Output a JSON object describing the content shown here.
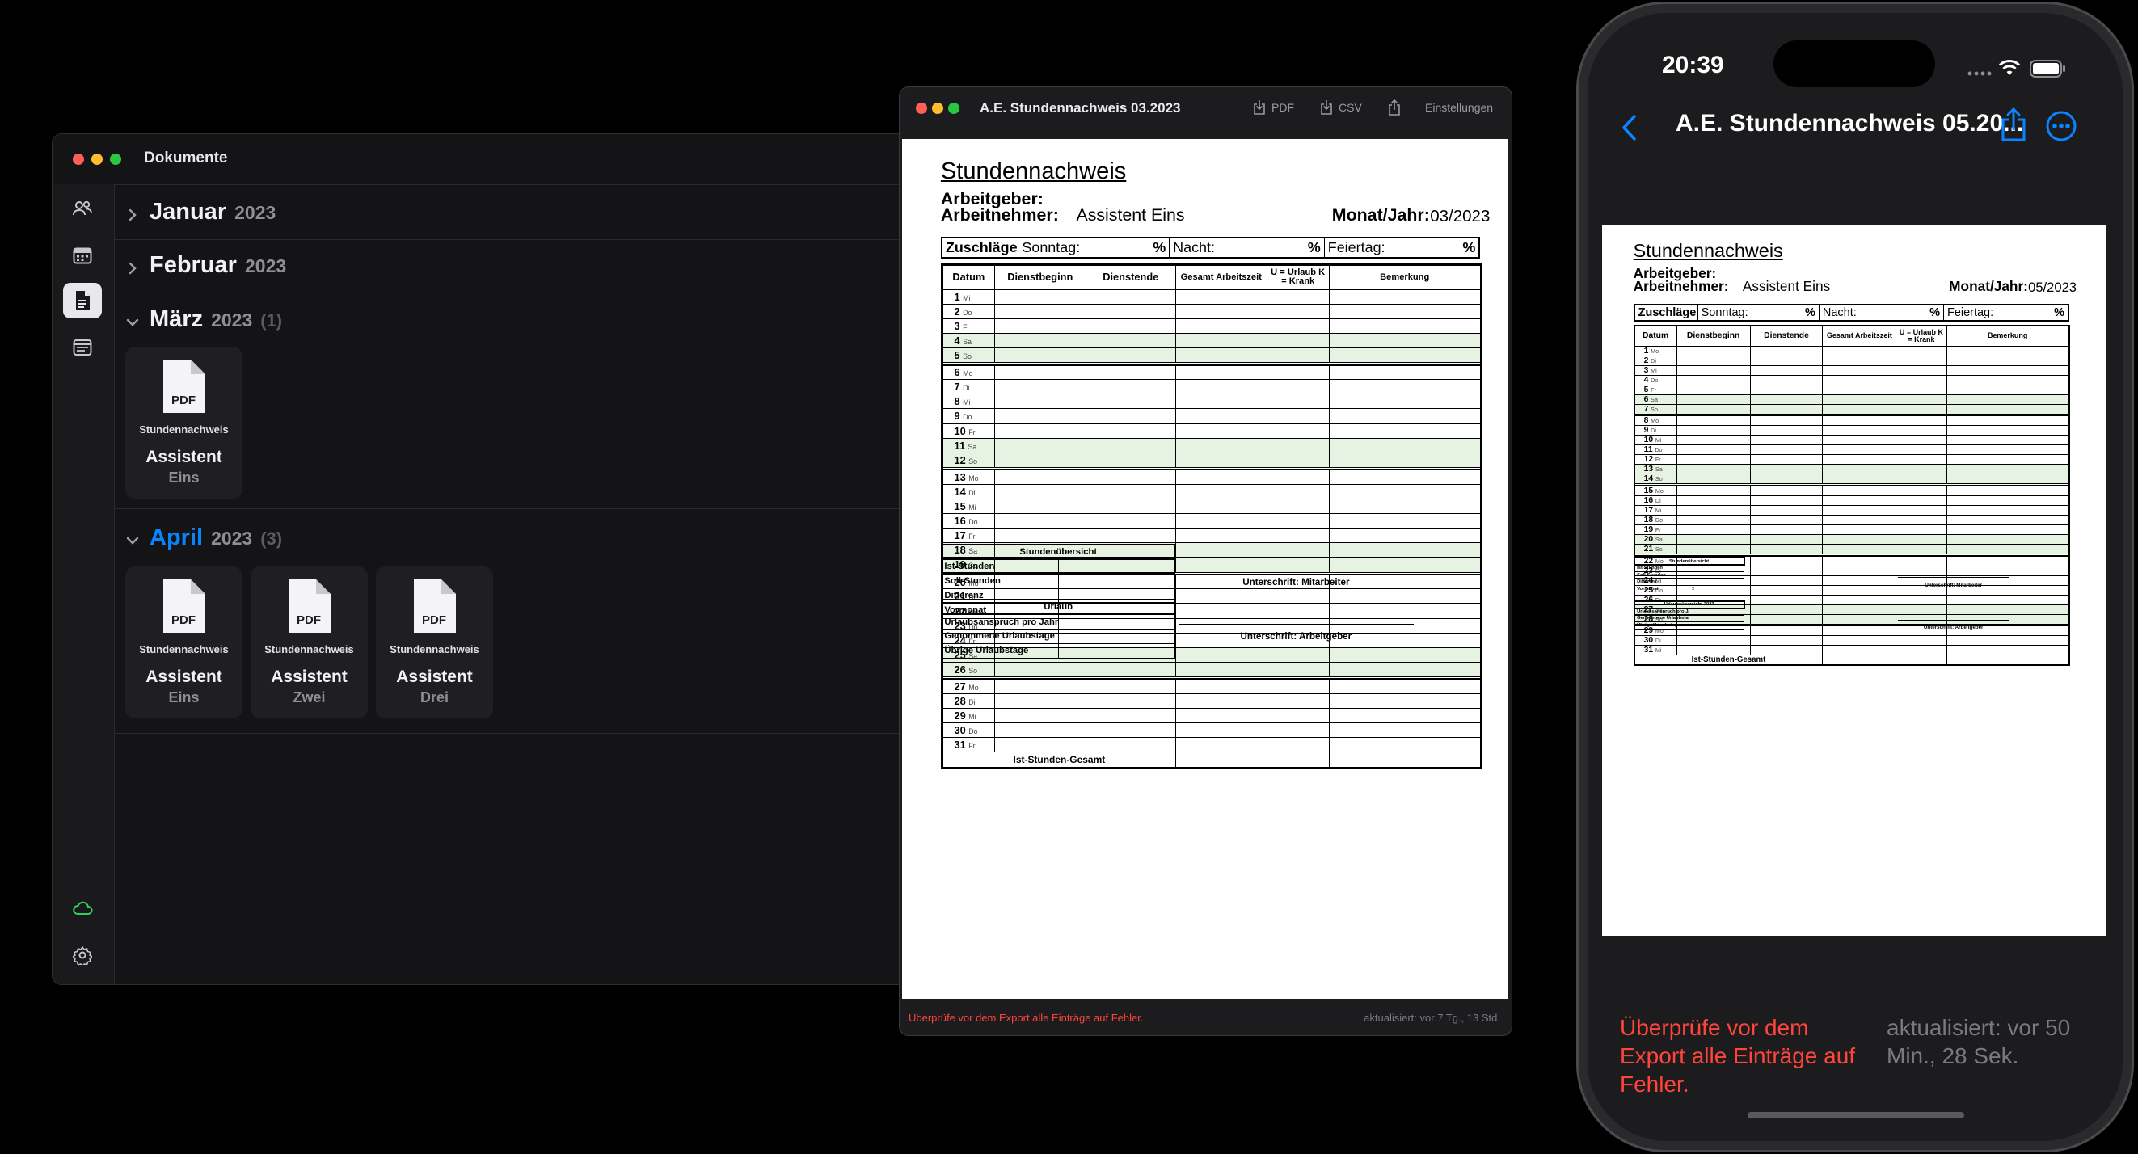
{
  "colors": {
    "accent": "#0a84ff",
    "error": "#ff453a",
    "weekend": "#e6f3e3",
    "cloud": "#30d158"
  },
  "mac_window": {
    "title": "Dokumente",
    "sidebar_icons": [
      "people-icon",
      "calendar-icon",
      "document-icon",
      "list-icon",
      "cloud-icon",
      "gear-icon"
    ],
    "months": [
      {
        "name": "Januar",
        "year": "2023",
        "count": ""
      },
      {
        "name": "Februar",
        "year": "2023",
        "count": ""
      },
      {
        "name": "März",
        "year": "2023",
        "count": "(1)"
      },
      {
        "name": "April",
        "year": "2023",
        "count": "(3)"
      }
    ],
    "documents": [
      {
        "icon": "PDF",
        "type": "Stundennachweis",
        "name": "Assistent",
        "sub": "Eins"
      },
      {
        "icon": "PDF",
        "type": "Stundennachweis",
        "name": "Assistent",
        "sub": "Eins"
      },
      {
        "icon": "PDF",
        "type": "Stundennachweis",
        "name": "Assistent",
        "sub": "Zwei"
      },
      {
        "icon": "PDF",
        "type": "Stundennachweis",
        "name": "Assistent",
        "sub": "Drei"
      }
    ]
  },
  "preview_window": {
    "title": "A.E. Stundennachweis 03.2023",
    "toolbar": {
      "pdf": "PDF",
      "csv": "CSV",
      "settings": "Einstellungen"
    },
    "status_left": "Überprüfe vor dem Export alle Einträge auf Fehler.",
    "status_right": "aktualisiert: vor 7 Tg., 13 Std.",
    "monat_jahr": "03/2023",
    "days": [
      {
        "n": "1",
        "wd": "Mi"
      },
      {
        "n": "2",
        "wd": "Do"
      },
      {
        "n": "3",
        "wd": "Fr"
      },
      {
        "n": "4",
        "wd": "Sa"
      },
      {
        "n": "5",
        "wd": "So"
      },
      {
        "n": "6",
        "wd": "Mo"
      },
      {
        "n": "7",
        "wd": "Di"
      },
      {
        "n": "8",
        "wd": "Mi"
      },
      {
        "n": "9",
        "wd": "Do"
      },
      {
        "n": "10",
        "wd": "Fr"
      },
      {
        "n": "11",
        "wd": "Sa"
      },
      {
        "n": "12",
        "wd": "So"
      },
      {
        "n": "13",
        "wd": "Mo"
      },
      {
        "n": "14",
        "wd": "Di"
      },
      {
        "n": "15",
        "wd": "Mi"
      },
      {
        "n": "16",
        "wd": "Do"
      },
      {
        "n": "17",
        "wd": "Fr"
      },
      {
        "n": "18",
        "wd": "Sa"
      },
      {
        "n": "19",
        "wd": "So"
      },
      {
        "n": "20",
        "wd": "Mo"
      },
      {
        "n": "21",
        "wd": "Di"
      },
      {
        "n": "22",
        "wd": "Mi"
      },
      {
        "n": "23",
        "wd": "Do"
      },
      {
        "n": "24",
        "wd": "Fr"
      },
      {
        "n": "25",
        "wd": "Sa"
      },
      {
        "n": "26",
        "wd": "So"
      },
      {
        "n": "27",
        "wd": "Mo"
      },
      {
        "n": "28",
        "wd": "Di"
      },
      {
        "n": "29",
        "wd": "Mi"
      },
      {
        "n": "30",
        "wd": "Do"
      },
      {
        "n": "31",
        "wd": "Fr"
      }
    ],
    "vormonat": "",
    "urlaub_title": "Urlaub"
  },
  "phone": {
    "time": "20:39",
    "title": "A.E. Stundennachweis 05.20...",
    "status_left": "Überprüfe vor dem Export alle Einträge auf Fehler.",
    "status_right": "aktualisiert: vor 50 Min., 28 Sek.",
    "monat_jahr": "05/2023",
    "days": [
      {
        "n": "1",
        "wd": "Mo"
      },
      {
        "n": "2",
        "wd": "Di"
      },
      {
        "n": "3",
        "wd": "Mi"
      },
      {
        "n": "4",
        "wd": "Do"
      },
      {
        "n": "5",
        "wd": "Fr"
      },
      {
        "n": "6",
        "wd": "Sa"
      },
      {
        "n": "7",
        "wd": "So"
      },
      {
        "n": "8",
        "wd": "Mo"
      },
      {
        "n": "9",
        "wd": "Di"
      },
      {
        "n": "10",
        "wd": "Mi"
      },
      {
        "n": "11",
        "wd": "Do"
      },
      {
        "n": "12",
        "wd": "Fr"
      },
      {
        "n": "13",
        "wd": "Sa"
      },
      {
        "n": "14",
        "wd": "So"
      },
      {
        "n": "15",
        "wd": "Mo"
      },
      {
        "n": "16",
        "wd": "Di"
      },
      {
        "n": "17",
        "wd": "Mi"
      },
      {
        "n": "18",
        "wd": "Do"
      },
      {
        "n": "19",
        "wd": "Fr"
      },
      {
        "n": "20",
        "wd": "Sa"
      },
      {
        "n": "21",
        "wd": "So"
      },
      {
        "n": "22",
        "wd": "Mo"
      },
      {
        "n": "23",
        "wd": "Di"
      },
      {
        "n": "24",
        "wd": "Mi"
      },
      {
        "n": "25",
        "wd": "Do"
      },
      {
        "n": "26",
        "wd": "Fr"
      },
      {
        "n": "27",
        "wd": "Sa"
      },
      {
        "n": "28",
        "wd": "So"
      },
      {
        "n": "29",
        "wd": "Mo"
      },
      {
        "n": "30",
        "wd": "Di"
      },
      {
        "n": "31",
        "wd": "Mi"
      }
    ],
    "vormonat": "2",
    "urlaub_title": "Urlaubsübersicht 2023"
  },
  "sheet": {
    "title": "Stundennachweis",
    "arbeitgeber_label": "Arbeitgeber:",
    "arbeitnehmer_label": "Arbeitnehmer:",
    "arbeitnehmer_value": "Assistent Eins",
    "monat_label": "Monat/Jahr:",
    "zuschlaege": "Zuschläge",
    "sonntag": "Sonntag:",
    "nacht": "Nacht:",
    "feiertag": "Feiertag:",
    "percent": "%",
    "columns": [
      "Datum",
      "Dienstbeginn",
      "Dienstende",
      "Gesamt Arbeitszeit",
      "U = Urlaub K = Krank",
      "Bemerkung"
    ],
    "total_label": "Ist-Stunden-Gesamt",
    "overview_title": "Stundenübersicht",
    "overview_rows": [
      "Ist-Stunden",
      "Soll-Stunden",
      "Differenz",
      "Vormonat"
    ],
    "vacation_rows": [
      "Urlaubsanspruch pro Jahr",
      "Genommene Urlaubstage",
      "Übrige Urlaubstage"
    ],
    "sig_employee": "Unterschrift: Mitarbeiter",
    "sig_employer": "Unterschrift: Arbeitgeber"
  }
}
